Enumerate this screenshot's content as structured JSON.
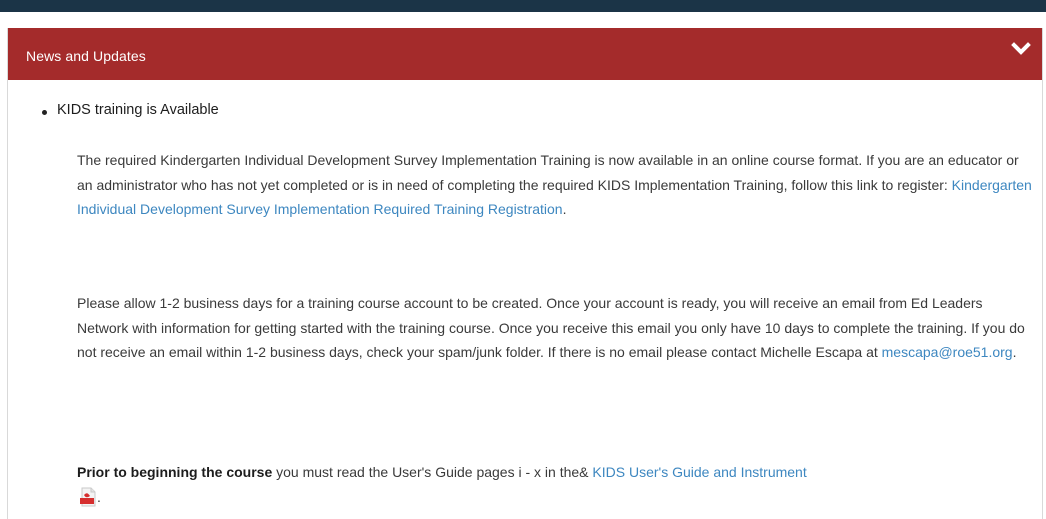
{
  "colors": {
    "top_bar": "#1b3447",
    "header_bg": "#a42b2b",
    "link": "#3d87c0"
  },
  "panel": {
    "title": "News and Updates",
    "toggle_icon": "chevron-down-icon"
  },
  "news_item": {
    "title": "KIDS training is Available",
    "p1_text": "The required Kindergarten Individual Development Survey Implementation Training is now available in an online course format. If you are an educator or an administrator who has not yet completed or is in need of completing the required KIDS Implementation Training, follow this link to register: ",
    "p1_link": "Kindergarten Individual Development Survey Implementation Required Training Registration",
    "p1_end": ".",
    "p2_text": "Please allow 1-2 business days for a training course account to be created. Once your account is ready, you will receive an email from Ed Leaders Network with information for getting started with the training course. Once you receive this email you only have 10 days to complete the training. If you do not receive an email within 1-2 business days, check your spam/junk folder. If there is no email please contact Michelle Escapa at ",
    "p2_link": "mescapa@roe51.org",
    "p2_end": ".",
    "p3_bold": "Prior to beginning the course",
    "p3_text": " you must read the User's Guide pages i - x in the& ",
    "p3_link": "KIDS User's Guide and Instrument",
    "p3_icon": "pdf-icon",
    "p3_end": "."
  }
}
